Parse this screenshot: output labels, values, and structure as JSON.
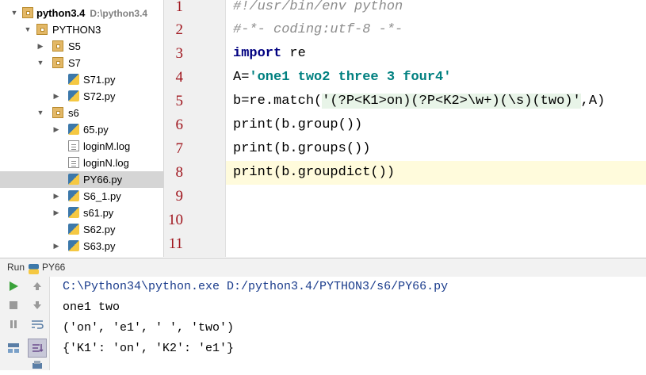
{
  "project_tree": {
    "root_name": "python3.4",
    "root_path": "D:\\python3.4",
    "items": [
      {
        "label": "PYTHON3",
        "kind": "folder"
      },
      {
        "label": "S5",
        "kind": "folder"
      },
      {
        "label": "S7",
        "kind": "folder"
      },
      {
        "label": "S71.py",
        "kind": "py"
      },
      {
        "label": "S72.py",
        "kind": "py"
      },
      {
        "label": "s6",
        "kind": "folder"
      },
      {
        "label": "65.py",
        "kind": "py"
      },
      {
        "label": "loginM.log",
        "kind": "file"
      },
      {
        "label": "loginN.log",
        "kind": "file"
      },
      {
        "label": "PY66.py",
        "kind": "py"
      },
      {
        "label": "S6_1.py",
        "kind": "py"
      },
      {
        "label": "s61.py",
        "kind": "py"
      },
      {
        "label": "S62.py",
        "kind": "py"
      },
      {
        "label": "S63.py",
        "kind": "py"
      }
    ]
  },
  "editor": {
    "line_numbers": [
      "1",
      "2",
      "3",
      "4",
      "5",
      "6",
      "7",
      "8",
      "9",
      "10",
      "11"
    ],
    "lines": {
      "l1": "#!/usr/bin/env python",
      "l2": "#-*- coding:utf-8 -*-",
      "l3_kw": "import",
      "l3_rest": " re",
      "l4_a": "A=",
      "l4_str": "'one1 two2 three 3 four4'",
      "l5_a": "b=re.match(",
      "l5_str": "'(?P<K1>on)(?P<K2>\\w+)(\\s)(two)'",
      "l5_b": ",A)",
      "l6": "print(b.group())",
      "l7": "print(b.groups())",
      "l8": "print(b.groupdict())"
    }
  },
  "run_panel": {
    "label": "Run",
    "config_name": "PY66",
    "output": {
      "command": "C:\\Python34\\python.exe D:/python3.4/PYTHON3/s6/PY66.py",
      "line1": "one1 two",
      "line2": "('on', 'e1', ' ', 'two')",
      "line3": "{'K1': 'on', 'K2': 'e1'}"
    }
  },
  "colors": {
    "line_number": "#a0161e",
    "keyword": "#000080",
    "string": "#008080",
    "comment": "#8c8c8c",
    "current_line": "#fffbdc",
    "run_green": "#3aa23a"
  }
}
